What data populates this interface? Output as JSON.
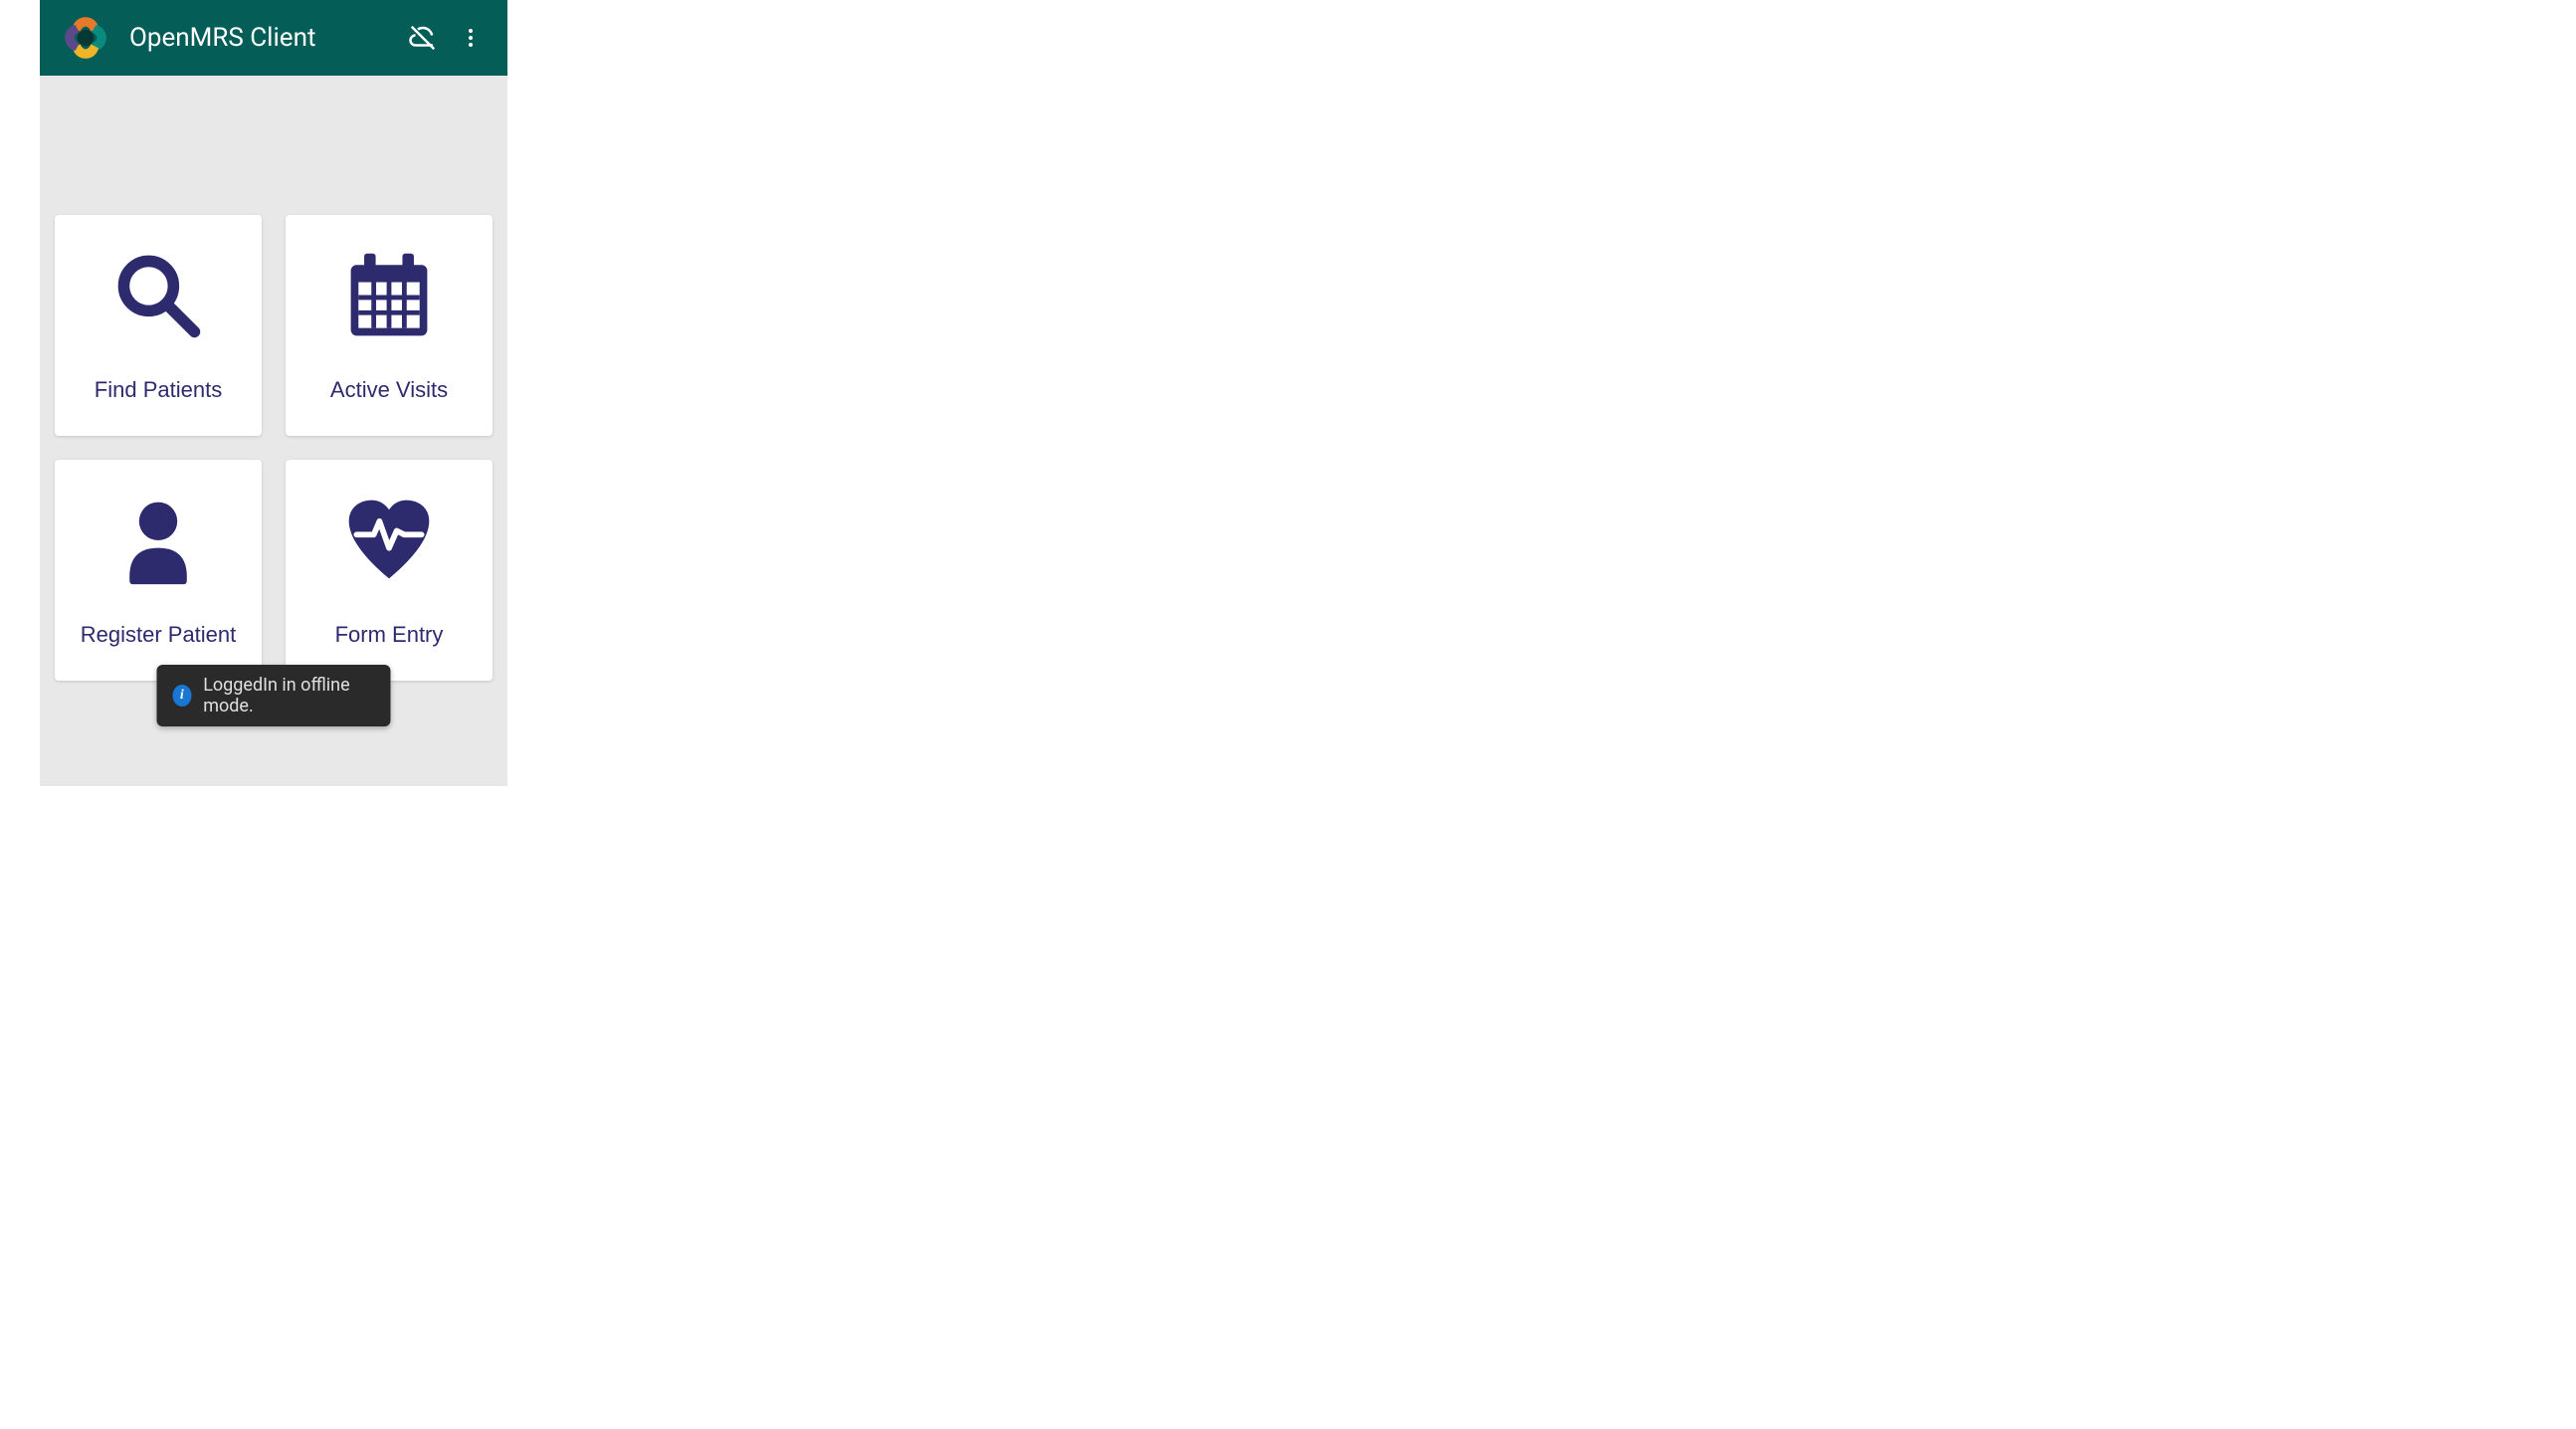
{
  "header": {
    "title": "OpenMRS Client"
  },
  "tiles": {
    "find_patients": "Find Patients",
    "active_visits": "Active Visits",
    "register_patient": "Register Patient",
    "form_entry": "Form Entry"
  },
  "toast": {
    "message": "LoggedIn in offline mode."
  },
  "colors": {
    "header_bg": "#045d56",
    "icon_fill": "#2d2a6e"
  }
}
